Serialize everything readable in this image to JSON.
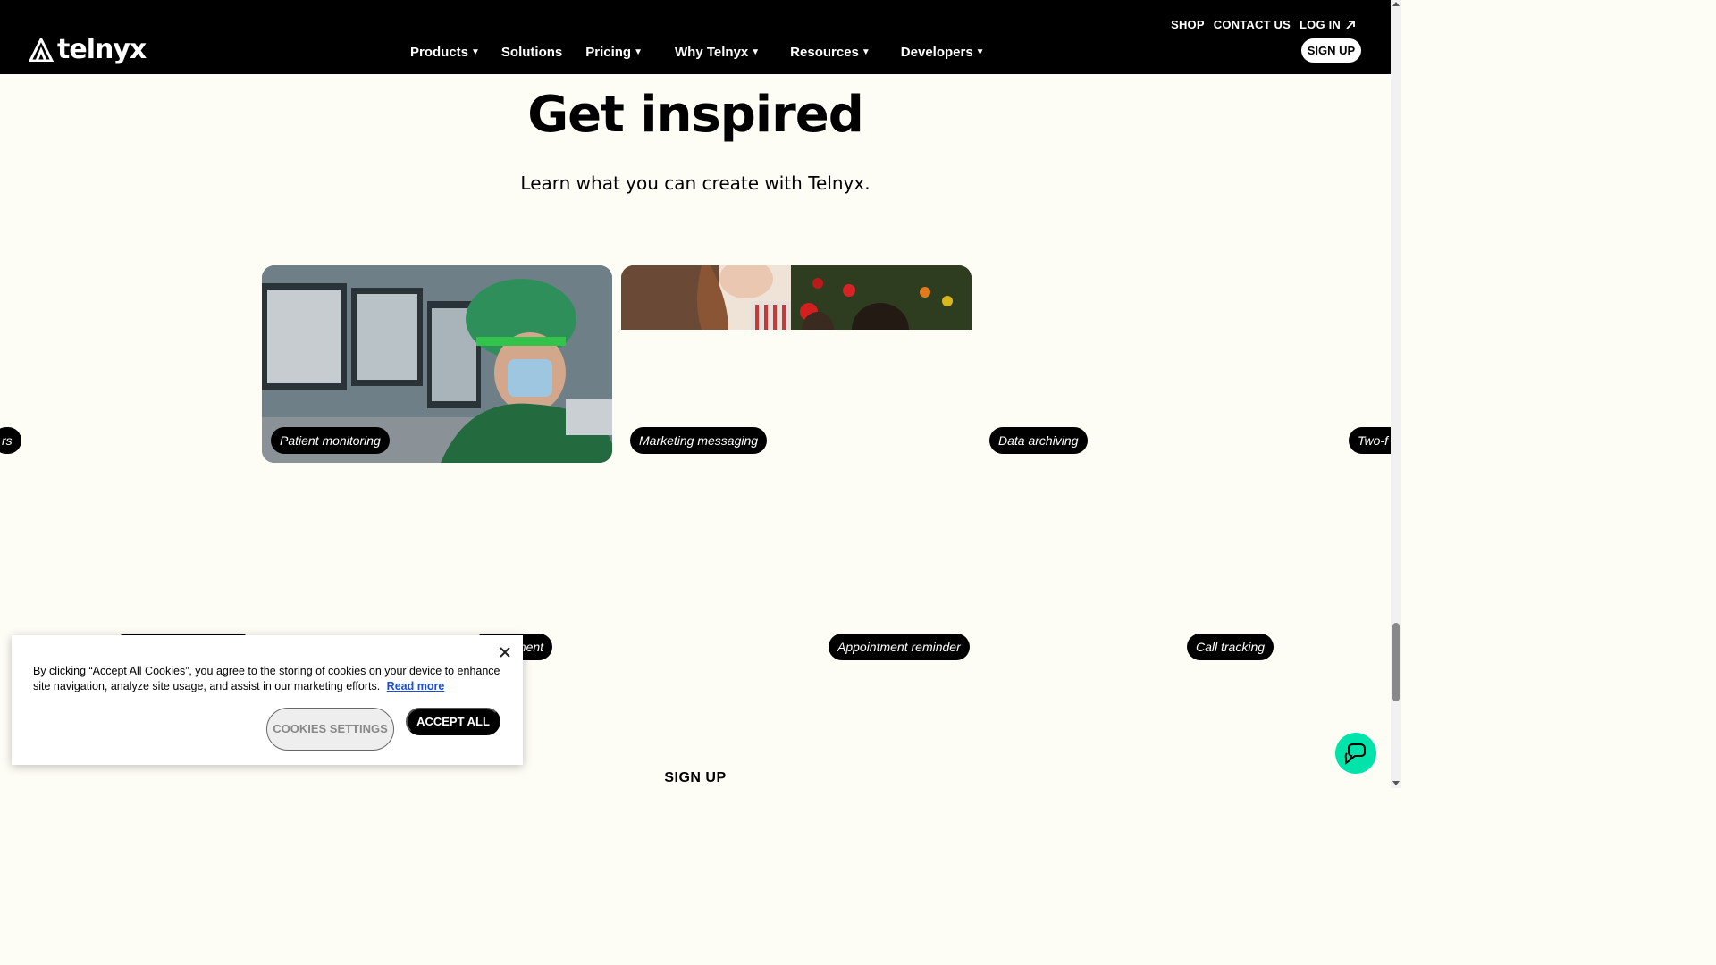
{
  "header": {
    "logo_text": "telnyx",
    "top_links": {
      "shop": "SHOP",
      "contact": "CONTACT US",
      "login": "LOG IN"
    },
    "nav": [
      {
        "label": "Products",
        "has_caret": true
      },
      {
        "label": "Solutions",
        "has_caret": false
      },
      {
        "label": "Pricing",
        "has_caret": true
      },
      {
        "label": "Why Telnyx",
        "has_caret": true
      },
      {
        "label": "Resources",
        "has_caret": true
      },
      {
        "label": "Developers",
        "has_caret": true
      }
    ],
    "signup": "SIGN UP"
  },
  "hero": {
    "title": "Get inspired",
    "subtitle": "Learn what you can create with Telnyx."
  },
  "cards": {
    "row1": [
      "rs",
      "Patient monitoring",
      "Marketing messaging",
      "Data archiving",
      "Two-f"
    ],
    "row2": [
      "",
      "anagement",
      "Appointment reminder",
      "Call tracking"
    ]
  },
  "cookie": {
    "text": "By clicking “Accept All Cookies”, you agree to the storing of cookies on your device to enhance site navigation, analyze site usage, and assist in our marketing efforts.",
    "read_more": "Read more",
    "settings": "COOKIES SETTINGS",
    "accept": "ACCEPT ALL"
  },
  "bottom": {
    "signup": "SIGN UP"
  },
  "colors": {
    "background": "#fefdf5",
    "header": "#000000",
    "accent_chat": "#00e3aa",
    "link": "#1a4ed8"
  }
}
